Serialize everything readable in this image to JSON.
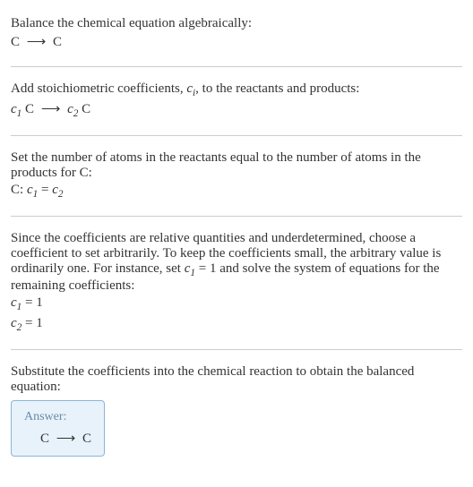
{
  "section1": {
    "line1": "Balance the chemical equation algebraically:",
    "eq_lhs": "C",
    "eq_arrow": "⟶",
    "eq_rhs": "C"
  },
  "section2": {
    "line1_a": "Add stoichiometric coefficients, ",
    "line1_ci": "c",
    "line1_i": "i",
    "line1_b": ", to the reactants and products:",
    "c1": "c",
    "c1_sub": "1",
    "sp1": " C ",
    "arrow": "⟶",
    "sp2": " ",
    "c2": "c",
    "c2_sub": "2",
    "sp3": " C"
  },
  "section3": {
    "line1": "Set the number of atoms in the reactants equal to the number of atoms in the products for C:",
    "prefix": "C:  ",
    "c1": "c",
    "c1_sub": "1",
    "eq": " = ",
    "c2": "c",
    "c2_sub": "2"
  },
  "section4": {
    "line1_a": "Since the coefficients are relative quantities and underdetermined, choose a coefficient to set arbitrarily. To keep the coefficients small, the arbitrary value is ordinarily one. For instance, set ",
    "c1": "c",
    "c1_sub": "1",
    "line1_b": " = 1 and solve the system of equations for the remaining coefficients:",
    "eq1_c": "c",
    "eq1_sub": "1",
    "eq1_rest": " = 1",
    "eq2_c": "c",
    "eq2_sub": "2",
    "eq2_rest": " = 1"
  },
  "section5": {
    "line1": "Substitute the coefficients into the chemical reaction to obtain the balanced equation:",
    "answer_label": "Answer:",
    "answer_lhs": "C",
    "answer_arrow": "⟶",
    "answer_rhs": "C"
  }
}
